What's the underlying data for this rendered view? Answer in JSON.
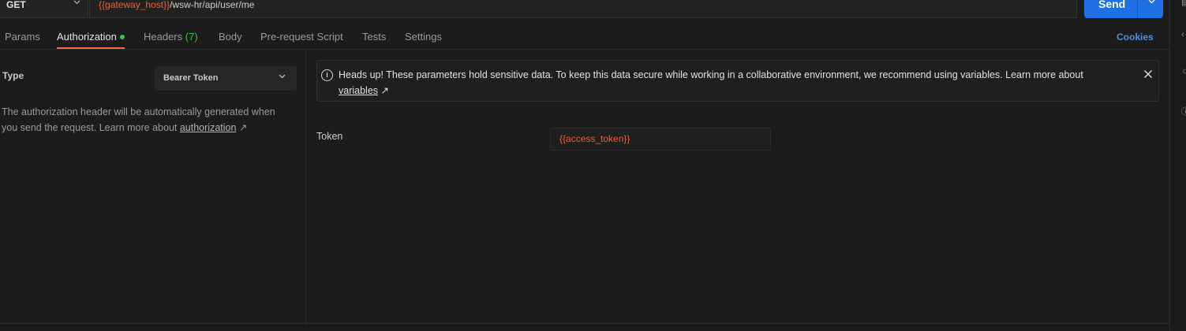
{
  "request": {
    "method": "GET",
    "url_variable": "{{gateway_host}}",
    "url_path": "/wsw-hr/api/user/me",
    "send_label": "Send"
  },
  "tabs": {
    "params": "Params",
    "authorization": "Authorization",
    "headers": "Headers",
    "headers_count": "(7)",
    "body": "Body",
    "prerequest": "Pre-request Script",
    "tests": "Tests",
    "settings": "Settings",
    "cookies": "Cookies"
  },
  "auth": {
    "type_label": "Type",
    "type_value": "Bearer Token",
    "description": "The authorization header will be automatically generated when you send the request. Learn more about ",
    "description_link": "authorization",
    "arrow": "↗"
  },
  "banner": {
    "message": "Heads up! These parameters hold sensitive data. To keep this data secure while working in a collaborative environment, we recommend using variables. Learn more about ",
    "link": "variables",
    "arrow": "↗"
  },
  "token": {
    "label": "Token",
    "value": "{{access_token}}"
  },
  "icons": {
    "method_chevron": "chevron-down-icon",
    "send_chevron": "chevron-down-icon",
    "info": "info-icon",
    "close": "close-icon"
  },
  "colors": {
    "accent_orange": "#e8623e",
    "send_blue": "#1f6fe5",
    "link_blue": "#4a90e2",
    "status_green": "#35c54a",
    "tab_underline": "#f26b3a"
  }
}
